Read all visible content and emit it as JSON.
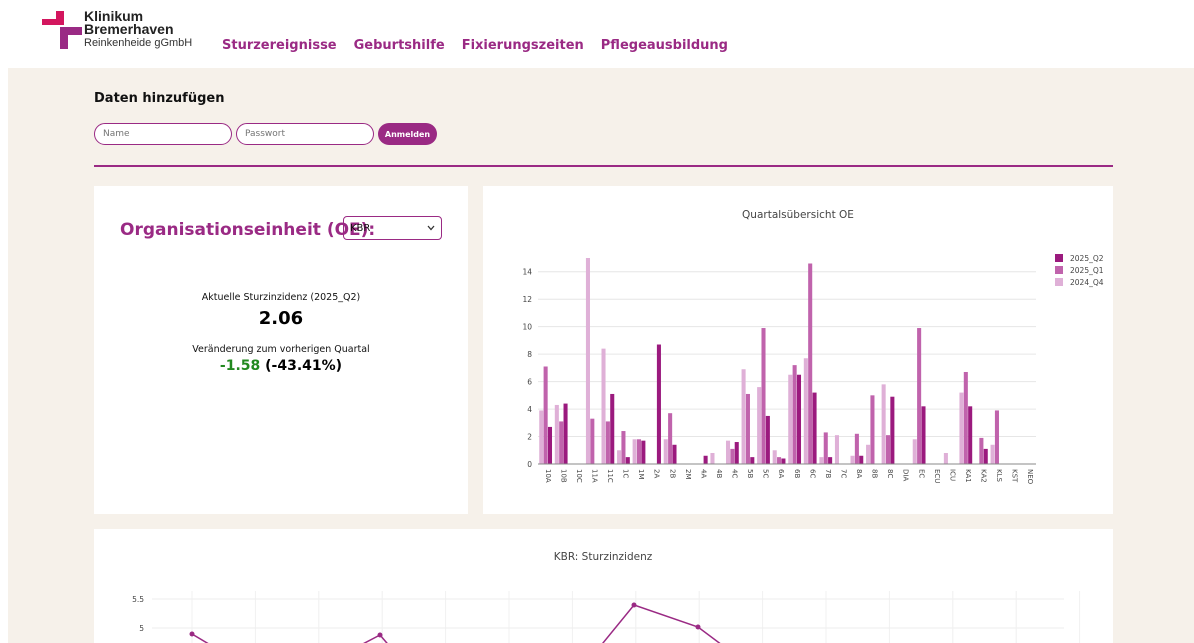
{
  "brand": {
    "line1": "Klinikum",
    "line2": "Bremerhaven",
    "line3": "Reinkenheide gGmbH"
  },
  "nav": [
    "Sturzereignisse",
    "Geburtshilfe",
    "Fixierungszeiten",
    "Pflegeausbildung"
  ],
  "login": {
    "title": "Daten hinzufügen",
    "name_placeholder": "Name",
    "password_placeholder": "Passwort",
    "button": "Anmelden"
  },
  "oe": {
    "label": "Organisationseinheit (OE):",
    "selected": "KBR"
  },
  "stats": {
    "current_label": "Aktuelle Sturzinzidenz (2025_Q2)",
    "current_value": "2.06",
    "change_label": "Veränderung zum vorherigen Quartal",
    "change_abs": "-1.58",
    "change_pct": "(-43.41%)"
  },
  "colors": {
    "accent": "#9a2a84",
    "q2": "#9b1a7e",
    "q1": "#c063ac",
    "q4": "#dfb0d7",
    "negative": "#22891f",
    "background": "#f6f1ea"
  },
  "chart_data": [
    {
      "type": "bar",
      "title": "Quartalsübersicht OE",
      "categories": [
        "10A",
        "10B",
        "10C",
        "11A",
        "11C",
        "1C",
        "1M",
        "2A",
        "2B",
        "2M",
        "4A",
        "4B",
        "4C",
        "5B",
        "5C",
        "6A",
        "6B",
        "6C",
        "7B",
        "7C",
        "8A",
        "8B",
        "8C",
        "DIA",
        "EC",
        "ECU",
        "ICU",
        "KA1",
        "KA2",
        "KLS",
        "KST",
        "NEO"
      ],
      "series": [
        {
          "name": "2024_Q4",
          "values": [
            3.9,
            4.3,
            0,
            15.0,
            8.4,
            1.0,
            1.8,
            0,
            1.8,
            0,
            0,
            0.8,
            1.7,
            6.9,
            5.6,
            1.0,
            6.5,
            7.7,
            0.5,
            2.1,
            0.6,
            1.4,
            5.8,
            0,
            1.8,
            0,
            0.8,
            5.2,
            0,
            1.4,
            0,
            0
          ]
        },
        {
          "name": "2025_Q1",
          "values": [
            7.1,
            3.1,
            0,
            3.3,
            3.1,
            2.4,
            1.8,
            0,
            3.7,
            0,
            0,
            0,
            1.1,
            5.1,
            9.9,
            0.5,
            7.2,
            14.6,
            2.3,
            0,
            2.2,
            5.0,
            2.1,
            0,
            9.9,
            0,
            0,
            6.7,
            1.9,
            3.9,
            0,
            0
          ]
        },
        {
          "name": "2025_Q2",
          "values": [
            2.7,
            4.4,
            0,
            0,
            5.1,
            0.5,
            1.7,
            8.7,
            1.4,
            0,
            0.6,
            0,
            1.6,
            0.5,
            3.5,
            0.4,
            6.5,
            5.2,
            0.5,
            0,
            0.6,
            0,
            4.9,
            0,
            4.2,
            0,
            0,
            4.2,
            1.1,
            0,
            0,
            0
          ]
        }
      ],
      "ylim": [
        0,
        15
      ],
      "yticks": [
        0,
        2,
        4,
        6,
        8,
        10,
        12,
        14
      ],
      "legend": "top-right",
      "grid": true
    },
    {
      "type": "line",
      "title": "KBR: Sturzinzidenz",
      "yticks": [
        5,
        5.5
      ],
      "ylim": [
        4.5,
        5.6
      ],
      "grid": true
    }
  ]
}
